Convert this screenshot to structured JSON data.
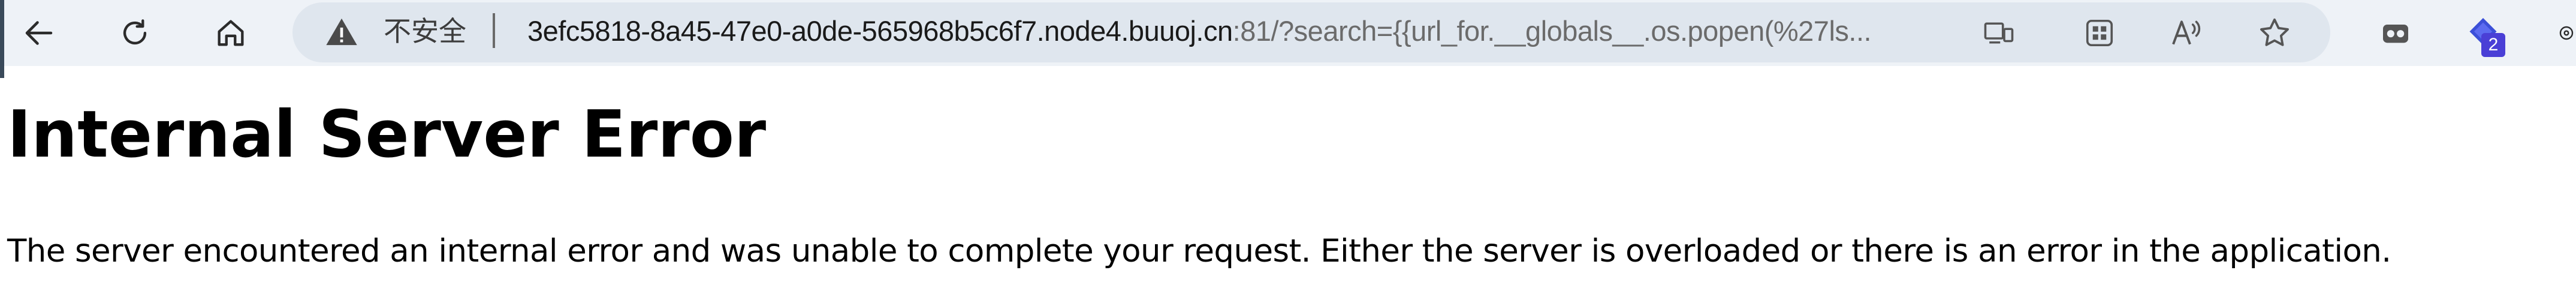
{
  "browser": {
    "security_label": "不安全",
    "url_host": "3efc5818-8a45-47e0-a0de-565968b5c6f7.node4.buuoj.cn",
    "url_rest": ":81/?search={{url_for.__globals__.os.popen(%27ls...",
    "extension_badge": "2",
    "icons": {
      "back": "back-arrow-icon",
      "reload": "reload-icon",
      "home": "home-icon",
      "warning": "warning-icon",
      "screencast": "screencast-icon",
      "apps": "apps-grid-icon",
      "read_aloud": "read-aloud-icon",
      "favorite": "favorite-star-icon",
      "tabs": "tab-actions-icon",
      "extension": "extension-icon"
    },
    "colors": {
      "toolbar": "#eef2f7",
      "address_bar": "#dfe6ee",
      "badge": "#4a3fd6"
    }
  },
  "page": {
    "title": "Internal Server Error",
    "message": "The server encountered an internal error and was unable to complete your request. Either the server is overloaded or there is an error in the application."
  }
}
